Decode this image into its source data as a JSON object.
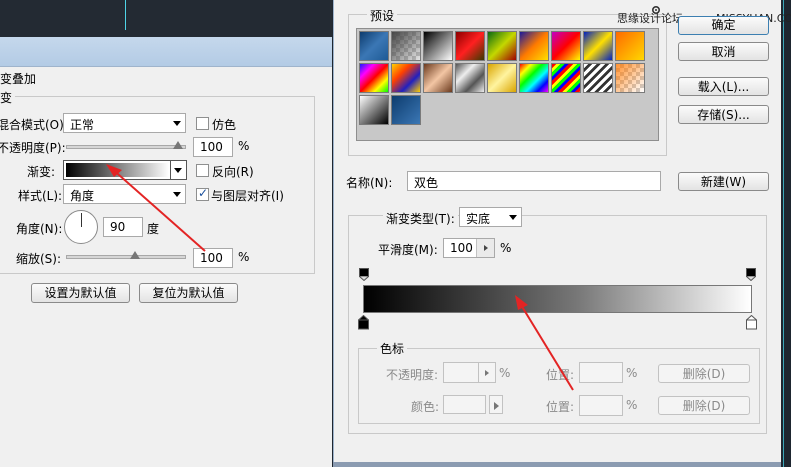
{
  "colors": {
    "accent": "#e32424",
    "titlebar": "#b8cfe8",
    "dark_bg": "#1f2731"
  },
  "left": {
    "title_partial": "变叠加",
    "group_label_partial": "变",
    "blend_mode_label": "混合模式(O):",
    "blend_mode_value": "正常",
    "dither_label": "仿色",
    "opacity_label": "不透明度(P):",
    "opacity_value": "100",
    "opacity_unit": "%",
    "gradient_label": "渐变:",
    "reverse_label": "反向(R)",
    "style_label": "样式(L):",
    "style_value": "角度",
    "align_label": "与图层对齐(I)",
    "align_checked": true,
    "angle_label": "角度(N):",
    "angle_value": "90",
    "angle_unit": "度",
    "scale_label": "缩放(S):",
    "scale_value": "100",
    "scale_unit": "%",
    "set_default_button": "设置为默认值",
    "reset_default_button": "复位为默认值"
  },
  "right": {
    "watermark": "思缘设计论坛 www.MISSYUAN.COM",
    "presets_label": "预设",
    "gear_icon": "gear-icon",
    "ok_button": "确定",
    "cancel_button": "取消",
    "load_button": "载入(L)...",
    "save_button": "存储(S)...",
    "name_label": "名称(N):",
    "name_value": "双色",
    "new_button": "新建(W)",
    "gradient_type_label": "渐变类型(T):",
    "gradient_type_value": "实底",
    "smoothness_label": "平滑度(M):",
    "smoothness_value": "100",
    "smoothness_unit": "%",
    "color_stops_label": "色标",
    "stop_opacity_label": "不透明度:",
    "stop_opacity_unit": "%",
    "stop_location_label_1": "位置:",
    "stop_location_unit_1": "%",
    "delete_button_1": "删除(D)",
    "stop_color_label": "颜色:",
    "stop_location_label_2": "位置:",
    "stop_location_unit_2": "%",
    "delete_button_2": "删除(D)"
  }
}
